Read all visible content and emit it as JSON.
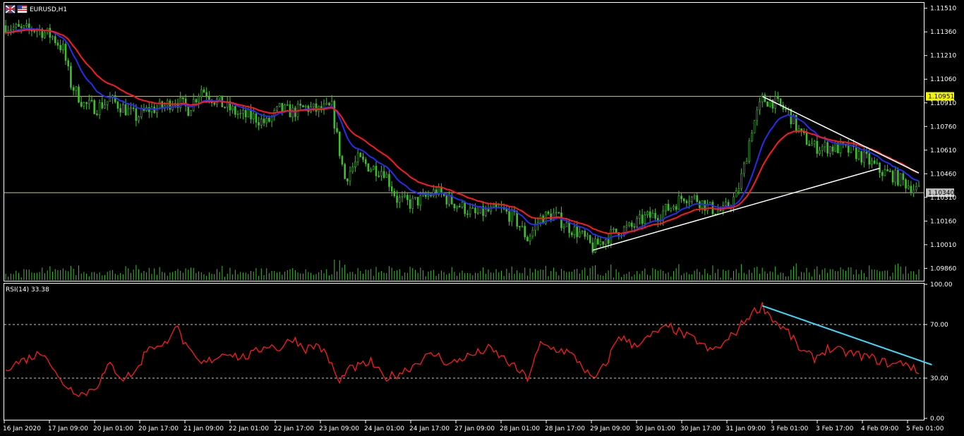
{
  "window": {
    "symbol_title": "EURUSD,H1",
    "flag_icon_left": "uk-flag-icon",
    "flag_icon_right": "us-flag-icon"
  },
  "colors": {
    "background": "#000000",
    "frame": "#ffffff",
    "candles": "#3fbf2f",
    "volume": "#3fbf2f",
    "ma_fast": "#2a2af0",
    "ma_slow": "#ff1a1a",
    "trendlines": "#ffffff",
    "hlines": "#c8c8a0",
    "rsi_line": "#ff1a1a",
    "rsi_trend": "#3fd8ff",
    "price_tag_yellow": "#f5f500",
    "price_tag_gray": "#bfbfbf"
  },
  "price_axis": {
    "labels": [
      "1.11510",
      "1.11360",
      "1.11210",
      "1.11060",
      "1.10910",
      "1.10760",
      "1.10610",
      "1.10460",
      "1.10310",
      "1.10160",
      "1.10010",
      "1.09860"
    ],
    "tag_upper": "1.10951",
    "tag_lower": "1.10340"
  },
  "rsi": {
    "title": "RSI(14) 33.38",
    "axis_labels": [
      "100.00",
      "70.00",
      "30.00",
      "0.00"
    ],
    "levels": [
      70,
      30
    ]
  },
  "time_axis": {
    "labels": [
      "16 Jan 2020",
      "17 Jan 09:00",
      "20 Jan 01:00",
      "20 Jan 17:00",
      "21 Jan 09:00",
      "22 Jan 01:00",
      "22 Jan 17:00",
      "23 Jan 09:00",
      "24 Jan 01:00",
      "24 Jan 17:00",
      "27 Jan 09:00",
      "28 Jan 01:00",
      "28 Jan 17:00",
      "29 Jan 09:00",
      "30 Jan 01:00",
      "30 Jan 17:00",
      "31 Jan 09:00",
      "3 Feb 01:00",
      "3 Feb 17:00",
      "4 Feb 09:00",
      "5 Feb 01:00"
    ]
  },
  "chart_data": [
    {
      "type": "candlestick",
      "title": "EURUSD,H1",
      "ylim": [
        1.0979,
        1.1154
      ],
      "hlines": [
        1.10951,
        1.1034
      ],
      "close_path": [
        [
          0,
          1.114
        ],
        [
          6,
          1.1137
        ],
        [
          12,
          1.1138
        ],
        [
          18,
          1.1133
        ],
        [
          22,
          1.1125
        ],
        [
          25,
          1.1103
        ],
        [
          30,
          1.109
        ],
        [
          35,
          1.1088
        ],
        [
          40,
          1.1093
        ],
        [
          45,
          1.1088
        ],
        [
          50,
          1.1082
        ],
        [
          55,
          1.1087
        ],
        [
          60,
          1.1088
        ],
        [
          65,
          1.1093
        ],
        [
          70,
          1.1087
        ],
        [
          75,
          1.11
        ],
        [
          80,
          1.1093
        ],
        [
          85,
          1.1088
        ],
        [
          90,
          1.1083
        ],
        [
          95,
          1.1082
        ],
        [
          100,
          1.1078
        ],
        [
          105,
          1.1087
        ],
        [
          110,
          1.1085
        ],
        [
          115,
          1.1088
        ],
        [
          120,
          1.1086
        ],
        [
          125,
          1.1088
        ],
        [
          128,
          1.106
        ],
        [
          130,
          1.1043
        ],
        [
          135,
          1.1055
        ],
        [
          140,
          1.105
        ],
        [
          145,
          1.1048
        ],
        [
          150,
          1.103
        ],
        [
          155,
          1.1027
        ],
        [
          160,
          1.103
        ],
        [
          165,
          1.1035
        ],
        [
          170,
          1.1029
        ],
        [
          175,
          1.1025
        ],
        [
          180,
          1.102
        ],
        [
          185,
          1.1022
        ],
        [
          190,
          1.1023
        ],
        [
          195,
          1.1018
        ],
        [
          200,
          1.1005
        ],
        [
          205,
          1.1018
        ],
        [
          210,
          1.102
        ],
        [
          215,
          1.1013
        ],
        [
          220,
          1.1008
        ],
        [
          225,
          1.0999
        ],
        [
          230,
          1.1005
        ],
        [
          235,
          1.101
        ],
        [
          240,
          1.1012
        ],
        [
          245,
          1.1018
        ],
        [
          250,
          1.102
        ],
        [
          255,
          1.1025
        ],
        [
          260,
          1.1032
        ],
        [
          265,
          1.103
        ],
        [
          270,
          1.1024
        ],
        [
          275,
          1.1022
        ],
        [
          280,
          1.1032
        ],
        [
          283,
          1.105
        ],
        [
          286,
          1.1075
        ],
        [
          290,
          1.1093
        ],
        [
          294,
          1.1092
        ],
        [
          300,
          1.1085
        ],
        [
          305,
          1.107
        ],
        [
          310,
          1.1063
        ],
        [
          315,
          1.1063
        ],
        [
          320,
          1.1062
        ],
        [
          325,
          1.106
        ],
        [
          330,
          1.1055
        ],
        [
          335,
          1.1048
        ],
        [
          340,
          1.1045
        ],
        [
          345,
          1.104
        ],
        [
          350,
          1.1035
        ]
      ],
      "series": [
        {
          "name": "",
          "kind": "ma_fast"
        },
        {
          "name": "",
          "kind": "ma_slow"
        }
      ]
    },
    {
      "type": "line",
      "title": "RSI(14) 33.38",
      "ylim": [
        0,
        100
      ],
      "last_value": 33.38,
      "levels": [
        70,
        30
      ],
      "values_path": [
        [
          0,
          38
        ],
        [
          10,
          46
        ],
        [
          15,
          50
        ],
        [
          20,
          30
        ],
        [
          25,
          22
        ],
        [
          30,
          18
        ],
        [
          35,
          25
        ],
        [
          40,
          40
        ],
        [
          45,
          30
        ],
        [
          50,
          35
        ],
        [
          55,
          55
        ],
        [
          60,
          52
        ],
        [
          65,
          70
        ],
        [
          70,
          50
        ],
        [
          75,
          40
        ],
        [
          80,
          45
        ],
        [
          85,
          50
        ],
        [
          90,
          45
        ],
        [
          95,
          48
        ],
        [
          100,
          55
        ],
        [
          105,
          52
        ],
        [
          110,
          60
        ],
        [
          115,
          52
        ],
        [
          120,
          55
        ],
        [
          125,
          40
        ],
        [
          128,
          25
        ],
        [
          130,
          35
        ],
        [
          140,
          42
        ],
        [
          145,
          30
        ],
        [
          150,
          33
        ],
        [
          155,
          38
        ],
        [
          160,
          45
        ],
        [
          165,
          48
        ],
        [
          170,
          40
        ],
        [
          175,
          45
        ],
        [
          180,
          48
        ],
        [
          185,
          52
        ],
        [
          190,
          46
        ],
        [
          195,
          38
        ],
        [
          200,
          30
        ],
        [
          205,
          55
        ],
        [
          210,
          52
        ],
        [
          215,
          50
        ],
        [
          220,
          42
        ],
        [
          225,
          28
        ],
        [
          230,
          40
        ],
        [
          235,
          62
        ],
        [
          240,
          55
        ],
        [
          245,
          58
        ],
        [
          250,
          65
        ],
        [
          255,
          68
        ],
        [
          260,
          62
        ],
        [
          265,
          58
        ],
        [
          270,
          50
        ],
        [
          275,
          55
        ],
        [
          280,
          65
        ],
        [
          285,
          77
        ],
        [
          290,
          84
        ],
        [
          295,
          72
        ],
        [
          300,
          64
        ],
        [
          305,
          50
        ],
        [
          310,
          45
        ],
        [
          315,
          52
        ],
        [
          320,
          50
        ],
        [
          325,
          48
        ],
        [
          330,
          46
        ],
        [
          335,
          43
        ],
        [
          340,
          40
        ],
        [
          345,
          42
        ],
        [
          350,
          33
        ]
      ]
    }
  ]
}
